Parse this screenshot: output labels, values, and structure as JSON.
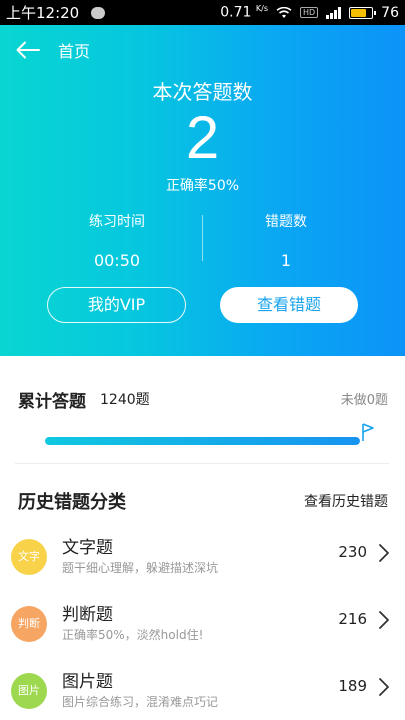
{
  "status_bar": {
    "time": "上午12:20",
    "speed": "0.71",
    "speed_unit": "K/s",
    "hd": "HD",
    "battery": "76",
    "icons": [
      "message-icon",
      "wifi-icon",
      "signal-icon",
      "battery-icon"
    ]
  },
  "header": {
    "back_label": "首页"
  },
  "summary": {
    "title": "本次答题数",
    "count": "2",
    "accuracy": "正确率50%",
    "practice_time_label": "练习时间",
    "practice_time_value": "00:50",
    "wrong_count_label": "错题数",
    "wrong_count_value": "1",
    "vip_button": "我的VIP",
    "review_button": "查看错题"
  },
  "cumulative": {
    "title": "累计答题",
    "count": "1240题",
    "remaining": "未做0题",
    "progress_fraction": 1.0
  },
  "history": {
    "title": "历史错题分类",
    "link": "查看历史错题",
    "categories": [
      {
        "badge": "文字",
        "badge_color": "#f8d34a",
        "name": "文字题",
        "desc": "题干细心理解，躲避描述深坑",
        "count": "230"
      },
      {
        "badge": "判断",
        "badge_color": "#f7a563",
        "name": "判断题",
        "desc": "正确率50%，淡然hold住!",
        "count": "216"
      },
      {
        "badge": "图片",
        "badge_color": "#9ed84f",
        "name": "图片题",
        "desc": "图片综合练习，混淆难点巧记",
        "count": "189"
      }
    ]
  },
  "colors": {
    "accent": "#1aa3ec",
    "gradient_start": "#09d6d2",
    "gradient_end": "#0c93f8"
  }
}
